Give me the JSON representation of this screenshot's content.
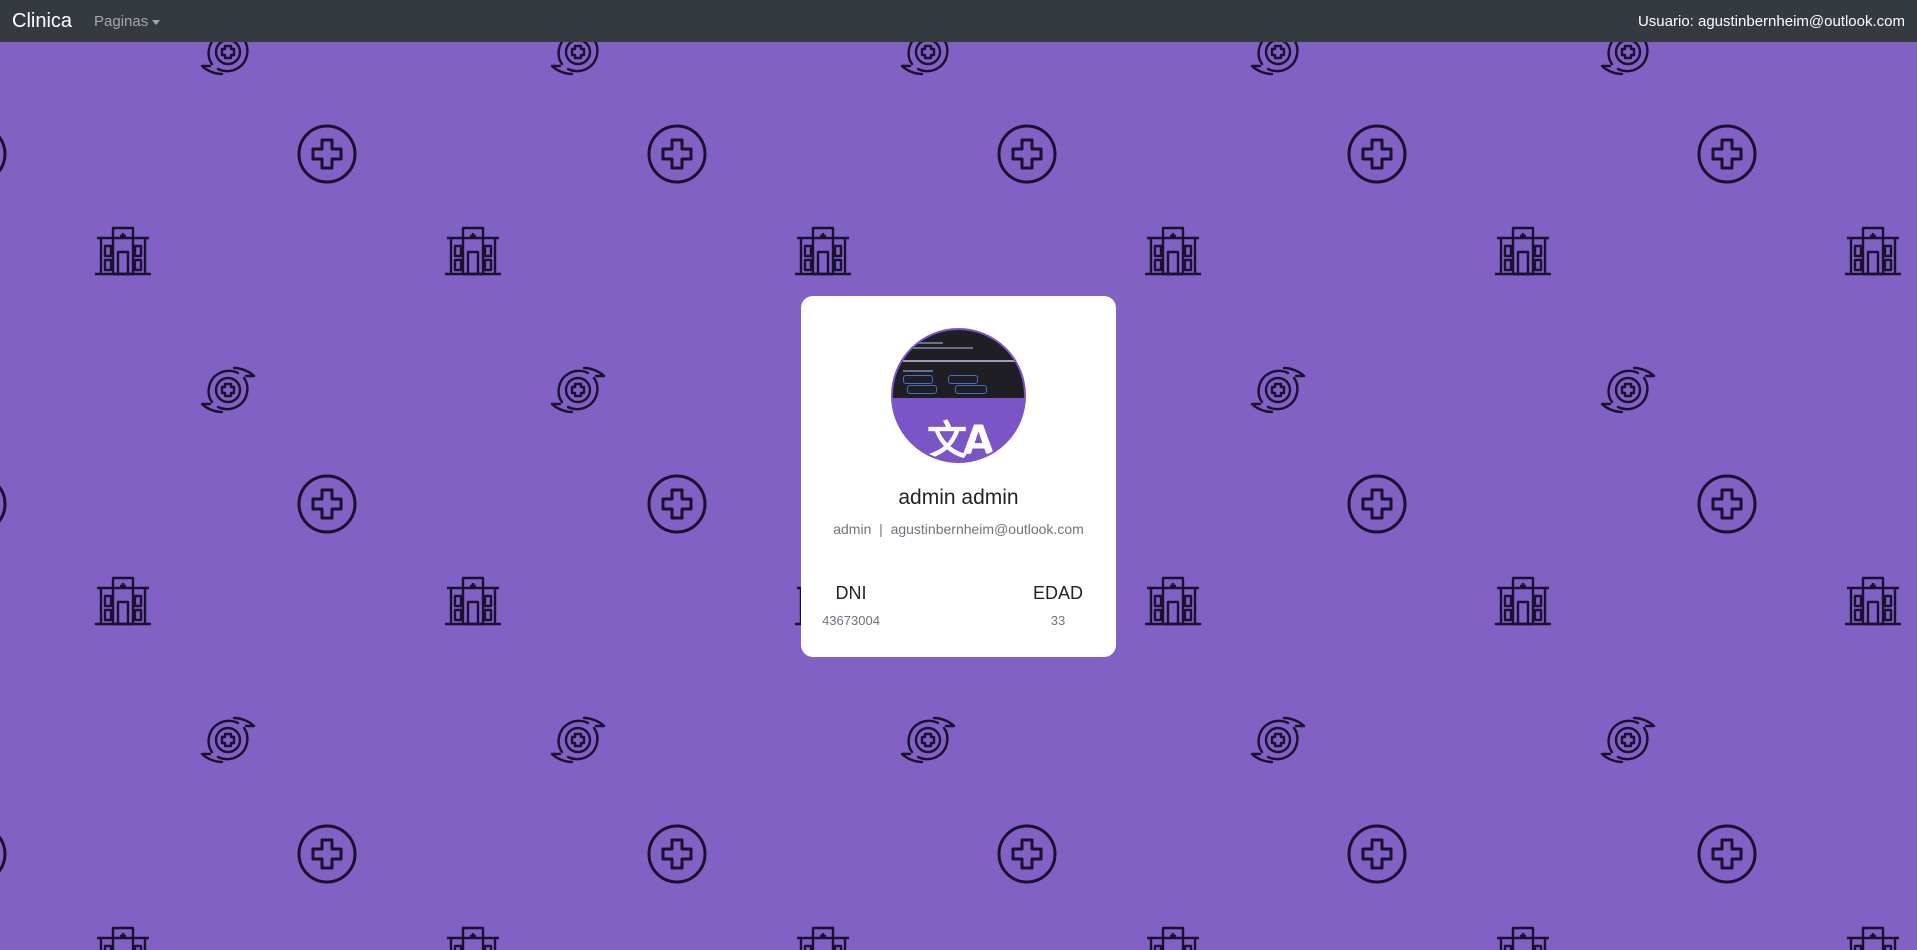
{
  "navbar": {
    "brand": "Clinica",
    "menu": "Paginas",
    "user": "Usuario: agustinbernheim@outlook.com"
  },
  "background": {
    "color": "#8261c5",
    "icons": [
      "plus-circle-icon",
      "hospital-icon",
      "care-hands-icon"
    ]
  },
  "profile": {
    "name": "admin admin",
    "role": "admin",
    "separator": "|",
    "email": "agustinbernheim@outlook.com",
    "avatar_glyph": "文A",
    "stats": [
      {
        "label": "DNI",
        "value": "43673004"
      },
      {
        "label": "EDAD",
        "value": "33"
      }
    ]
  }
}
